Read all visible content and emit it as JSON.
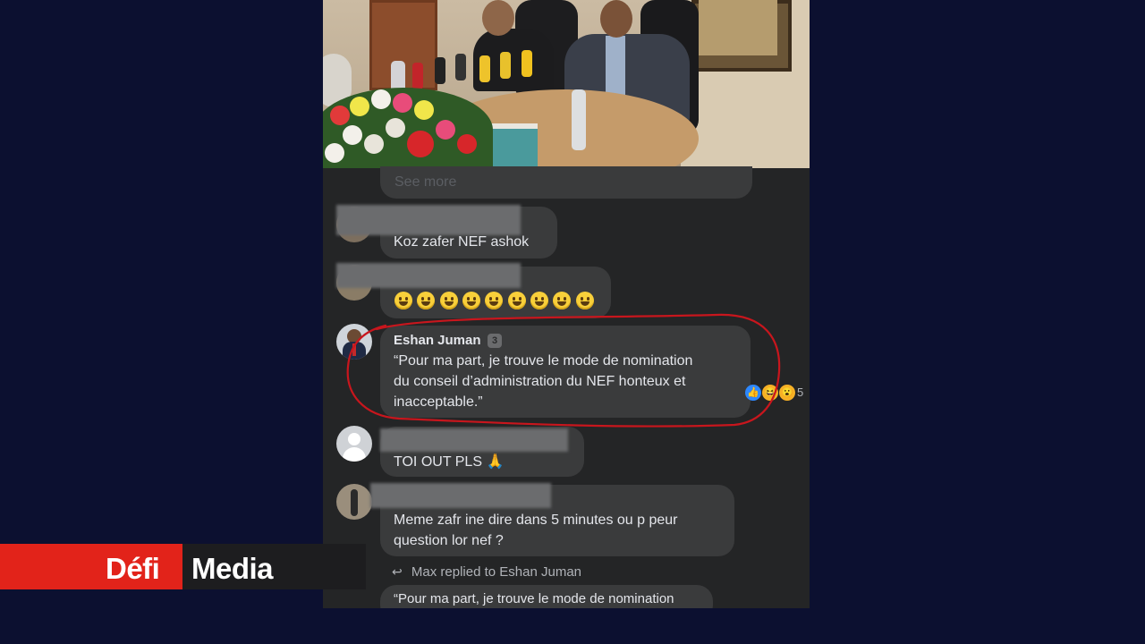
{
  "comments": {
    "see_more": "See more",
    "c1": {
      "text": "Koz zafer NEF ashok"
    },
    "c2": {
      "emoji_count": 9
    },
    "c3": {
      "author": "Eshan Juman",
      "badge": "3",
      "text": "“Pour ma part, je trouve le mode de nomination\ndu conseil d’administration du NEF honteux et\ninacceptable.”",
      "reaction_count": "5"
    },
    "c4": {
      "text": "TOI OUT PLS 🙏"
    },
    "c5": {
      "text": "Meme zafr ine dire dans 5 minutes ou p peur\nquestion lor nef ?"
    },
    "reply": {
      "label": "Max replied to Eshan Juman",
      "preview": "“Pour ma part, je trouve le mode de nomination"
    }
  },
  "logo": {
    "part1": "Défi",
    "part2": "Media"
  },
  "colors": {
    "background": "#0c1030",
    "panel": "#242526",
    "bubble": "#3a3b3c",
    "brand_red": "#e2231a",
    "highlight": "#c8161d"
  }
}
